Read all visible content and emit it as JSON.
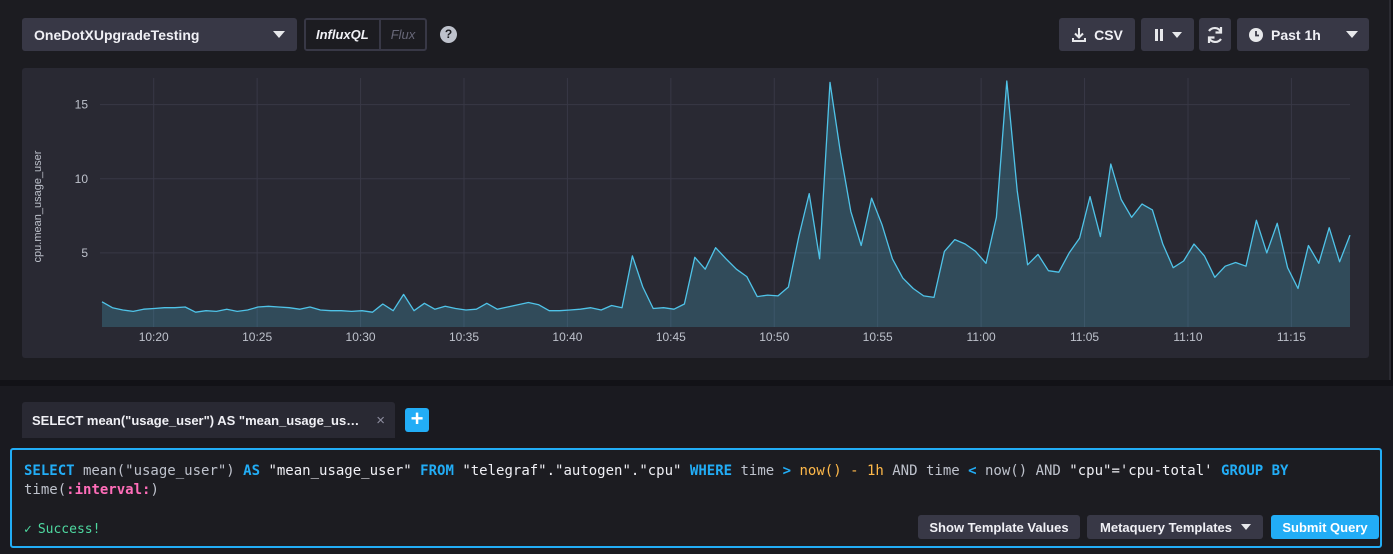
{
  "toolbar": {
    "database": "OneDotXUpgradeTesting",
    "lang_influxql": "InfluxQL",
    "lang_flux": "Flux",
    "help": "?",
    "csv_label": "CSV",
    "time_range": "Past 1h"
  },
  "colors": {
    "accent": "#22adf6",
    "series_line": "#4fc3e8",
    "success": "#4ed8a0"
  },
  "chart_data": {
    "type": "area",
    "ylabel": "cpu.mean_usage_user",
    "xlabel": "",
    "yticks": [
      5,
      10,
      15
    ],
    "ylim": [
      0,
      16.8
    ],
    "xticks": [
      "10:20",
      "10:25",
      "10:30",
      "10:35",
      "10:40",
      "10:45",
      "10:50",
      "10:55",
      "11:00",
      "11:05",
      "11:10",
      "11:15"
    ],
    "xlim": [
      "10:17:30",
      "11:17:50"
    ],
    "grid": true,
    "series": [
      {
        "values": [
          1.7,
          1.3,
          1.15,
          1.05,
          1.2,
          1.25,
          1.3,
          1.3,
          1.35,
          1.0,
          1.1,
          1.05,
          1.2,
          1.05,
          1.15,
          1.35,
          1.4,
          1.35,
          1.3,
          1.2,
          1.35,
          1.15,
          1.1,
          1.1,
          1.05,
          1.1,
          1.0,
          1.55,
          1.1,
          2.2,
          1.1,
          1.6,
          1.2,
          1.4,
          1.25,
          1.15,
          1.2,
          1.6,
          1.2,
          1.35,
          1.5,
          1.65,
          1.5,
          1.1,
          1.1,
          1.15,
          1.2,
          1.3,
          1.15,
          1.45,
          1.3,
          4.8,
          2.7,
          1.25,
          1.3,
          1.2,
          1.55,
          4.7,
          3.9,
          5.35,
          4.6,
          3.9,
          3.4,
          2.05,
          2.15,
          2.1,
          2.7,
          6.1,
          9.0,
          4.6,
          16.5,
          11.8,
          7.8,
          5.5,
          8.7,
          6.9,
          4.6,
          3.3,
          2.6,
          2.1,
          2.0,
          5.1,
          5.9,
          5.6,
          5.1,
          4.3,
          7.4,
          16.6,
          9.2,
          4.2,
          4.9,
          3.8,
          3.7,
          5.0,
          6.0,
          8.8,
          6.1,
          11.0,
          8.6,
          7.4,
          8.3,
          7.9,
          5.6,
          4.0,
          4.45,
          5.6,
          4.8,
          3.35,
          4.1,
          4.35,
          4.1,
          7.2,
          5.0,
          7.0,
          4.0,
          2.6,
          5.5,
          4.3,
          6.7,
          4.4,
          6.2
        ]
      }
    ]
  },
  "tab": {
    "label": "SELECT mean(\"usage_user\") AS \"mean_usage_us…",
    "close": "×",
    "add": "+"
  },
  "query": {
    "select": "SELECT",
    "fn1": " mean(\"usage_user\") ",
    "as": "AS",
    "alias": " \"mean_usage_user\" ",
    "from": "FROM",
    "source": " \"telegraf\".\"autogen\".\"cpu\" ",
    "where": "WHERE",
    "time1": " time ",
    "gt": ">",
    "now1": " now() ",
    "minus": "-",
    "dur": " 1h ",
    "and1": "AND",
    "time2": " time ",
    "lt": "<",
    "now2": " now() ",
    "and2": "AND",
    "cpu_cond": " \"cpu\"='cpu-total' ",
    "group": "GROUP BY",
    "time_fn": "time(",
    "interval": ":interval:",
    "close_paren": ")"
  },
  "status": {
    "check": "✓",
    "text": "Success!"
  },
  "buttons": {
    "template_values": "Show Template Values",
    "metaquery": "Metaquery Templates",
    "submit": "Submit Query"
  }
}
